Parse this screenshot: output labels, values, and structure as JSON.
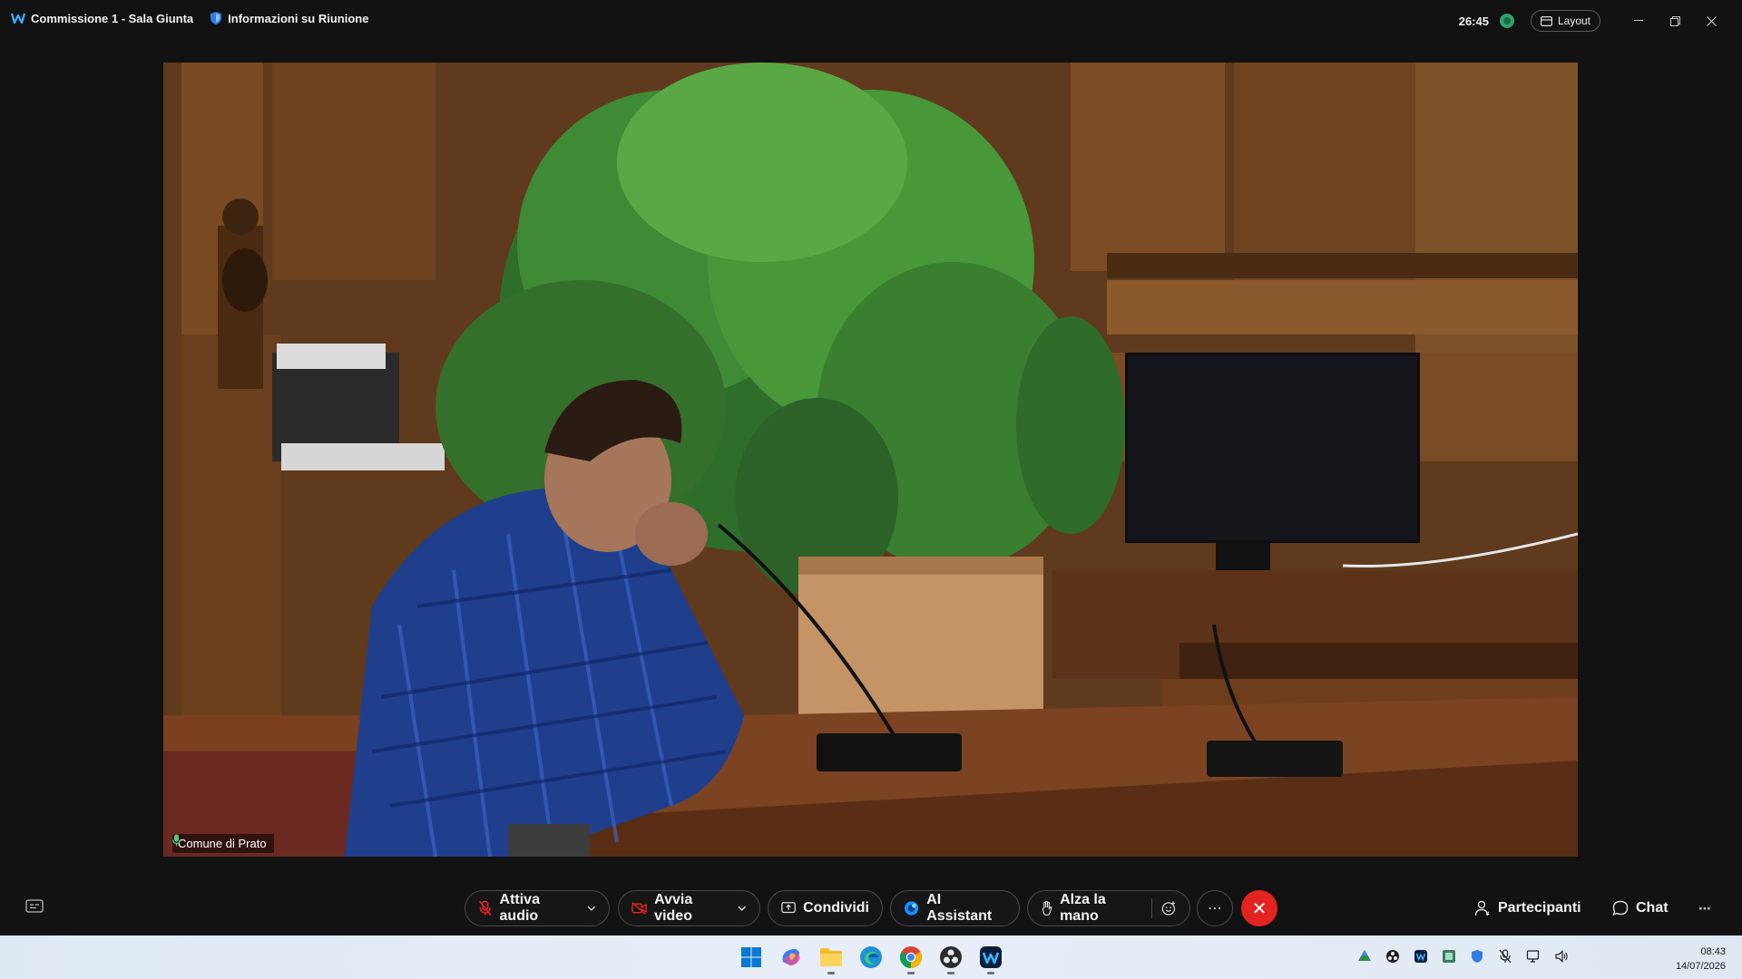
{
  "titlebar": {
    "meeting_title": "Commissione 1 - Sala Giunta",
    "info_label": "Informazioni su Riunione",
    "timer": "26:45",
    "layout_label": "Layout"
  },
  "video": {
    "participant_name": "Comune di Prato"
  },
  "toolbar": {
    "audio_label": "Attiva audio",
    "video_label": "Avvia video",
    "share_label": "Condividi",
    "ai_label": "AI Assistant",
    "raise_hand_label": "Alza la mano",
    "participants_label": "Partecipanti",
    "chat_label": "Chat",
    "more_icon": "⋯",
    "leave_icon": "✕"
  },
  "taskbar": {
    "time": "08:43",
    "date": "14/07/2026",
    "apps": [
      "windows-start",
      "copilot",
      "file-explorer",
      "edge",
      "chrome",
      "obs",
      "webex"
    ]
  },
  "colors": {
    "background": "#121212",
    "leave_red": "#e2231f",
    "accent_green": "#2ea36d"
  }
}
